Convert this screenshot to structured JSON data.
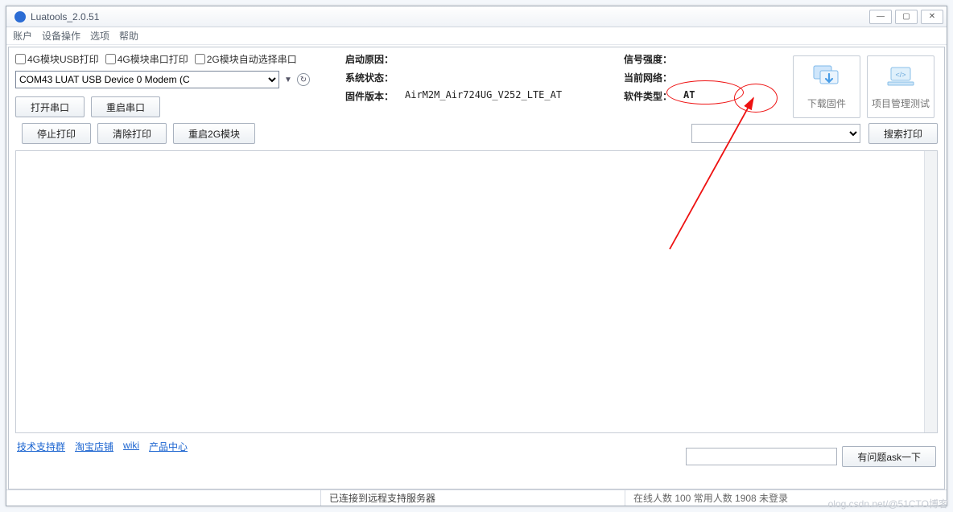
{
  "title": "Luatools_2.0.51",
  "menu": {
    "acct": "账户",
    "dev": "设备操作",
    "opt": "选项",
    "help": "帮助"
  },
  "checks": {
    "usb": "4G模块USB打印",
    "serial": "4G模块串口打印",
    "auto2g": "2G模块自动选择串口"
  },
  "combo_selected": "COM43 LUAT USB Device 0 Modem (C",
  "buttons": {
    "open": "打开串口",
    "reboot": "重启串口",
    "stop": "停止打印",
    "clear": "清除打印",
    "rb2g": "重启2G模块",
    "search": "搜索打印",
    "download": "下载固件",
    "project": "项目管理测试",
    "ask": "有问题ask一下"
  },
  "info_labels": {
    "boot": "启动原因：",
    "sys": "系统状态：",
    "fw": "固件版本：",
    "signal": "信号强度：",
    "net": "当前网络：",
    "swtype": "软件类型："
  },
  "info_values": {
    "boot": "",
    "sys": "",
    "fw": "AirM2M_Air724UG_V252_LTE_AT",
    "signal": "",
    "net": "",
    "swtype": "AT"
  },
  "links": {
    "tech": "技术支持群",
    "shop": "淘宝店铺",
    "wiki": "wiki",
    "prod": "产品中心"
  },
  "status": {
    "left": "",
    "mid": "已连接到远程支持服务器",
    "right": "在线人数 100 常用人数 1908 未登录"
  },
  "watermark": "olog.csdn.net/@51CTO博客"
}
